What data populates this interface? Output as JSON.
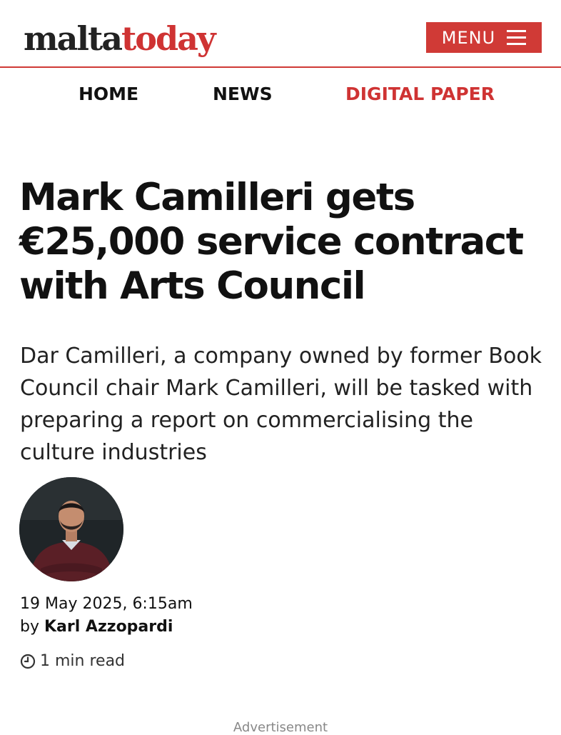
{
  "header": {
    "logo_part1": "malta",
    "logo_part2": "today",
    "menu_label": "MENU"
  },
  "nav": {
    "items": [
      "HOME",
      "NEWS",
      "DIGITAL PAPER"
    ]
  },
  "article": {
    "headline": "Mark Camilleri gets €25,000 service contract with Arts Council",
    "standfirst": "Dar Camilleri, a company owned by former Book Council chair Mark Camilleri, will be tasked with preparing a report on commercialising the culture industries",
    "date": "19 May 2025, 6:15am",
    "by_prefix": "by",
    "author": "Karl Azzopardi",
    "read_time": "1 min read"
  },
  "ad": {
    "label": "Advertisement"
  },
  "colors": {
    "brand_red": "#d03a36",
    "text": "#111111"
  },
  "icons": [
    "hamburger-icon",
    "clock-icon"
  ]
}
